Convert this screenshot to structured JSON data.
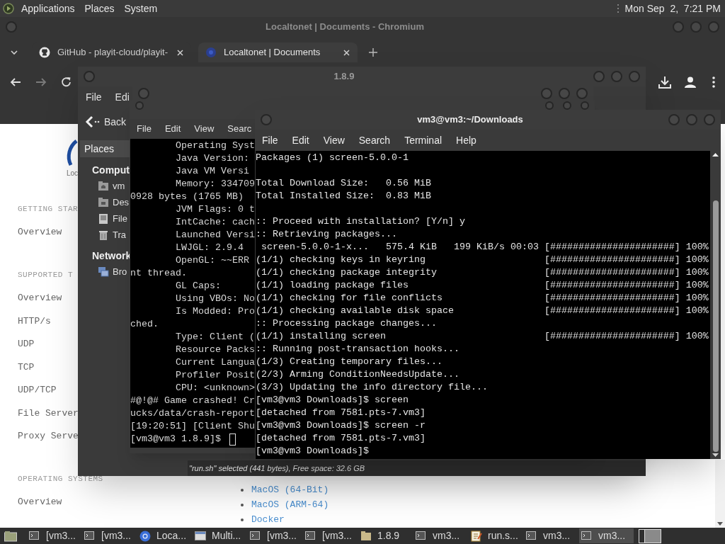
{
  "top_panel": {
    "menus": [
      "Applications",
      "Places",
      "System"
    ],
    "clock": "Mon Sep  2,  7:21 PM"
  },
  "browser": {
    "title": "Localtonet | Documents - Chromium",
    "tabs": [
      {
        "label": "GitHub - playit-cloud/playit-",
        "kind": "github",
        "selected": false
      },
      {
        "label": "Localtonet | Documents",
        "kind": "site",
        "selected": true
      }
    ],
    "forward_disabled": true,
    "page": {
      "logo_text": "Loc",
      "nav": [
        {
          "kind": "heading",
          "text": "GETTING STAR"
        },
        {
          "kind": "link",
          "text": "Overview"
        },
        {
          "kind": "heading",
          "text": "SUPPORTED T"
        },
        {
          "kind": "link",
          "text": "Overview"
        },
        {
          "kind": "link",
          "text": "HTTP/s"
        },
        {
          "kind": "link",
          "text": "UDP"
        },
        {
          "kind": "link",
          "text": "TCP"
        },
        {
          "kind": "link",
          "text": "UDP/TCP"
        },
        {
          "kind": "link",
          "text": "File Server"
        },
        {
          "kind": "link",
          "text": "Proxy Serve"
        },
        {
          "kind": "heading",
          "text": "OPERATING SYSTEMS"
        },
        {
          "kind": "link",
          "text": "Overview"
        }
      ],
      "list": [
        "MacOS (64-Bit)",
        "MacOS (ARM-64)",
        "Docker"
      ]
    }
  },
  "file_manager": {
    "title": "1.8.9",
    "menus": [
      "File",
      "Edi"
    ],
    "back": "Back",
    "places_header": "Places",
    "sidebar": [
      {
        "kind": "heading",
        "text": "Comput"
      },
      {
        "kind": "home",
        "text": "vm"
      },
      {
        "kind": "desktop",
        "text": "Des"
      },
      {
        "kind": "drive",
        "text": "File"
      },
      {
        "kind": "trash",
        "text": "Tra"
      },
      {
        "kind": "heading",
        "text": "Network"
      },
      {
        "kind": "network",
        "text": "Bro"
      }
    ],
    "status": "\"run.sh\" selected (441 bytes), Free space: 32.6 GB"
  },
  "terminal_back": {
    "menus": [
      "File",
      "Edit",
      "View",
      "Searc"
    ],
    "lines": [
      {
        "text": "Operating Syst",
        "indented": true
      },
      {
        "text": "Java Version:",
        "indented": true
      },
      {
        "text": "Java VM Versi",
        "indented": true
      },
      {
        "text": "Memory: 334709",
        "indented": true
      },
      {
        "text": "0928 bytes (1765 MB)",
        "indented": false
      },
      {
        "text": "JVM Flags: 0 t",
        "indented": true
      },
      {
        "text": "IntCache: cach",
        "indented": true
      },
      {
        "text": "Launched Versi",
        "indented": true
      },
      {
        "text": "LWJGL: 2.9.4",
        "indented": true
      },
      {
        "text": "OpenGL: ~~ERR",
        "indented": true
      },
      {
        "text": "nt thread.",
        "indented": false
      },
      {
        "text": "GL Caps:",
        "indented": true
      },
      {
        "text": "Using VBOs: No",
        "indented": true
      },
      {
        "text": "Is Modded: Pro",
        "indented": true
      },
      {
        "text": "ched.",
        "indented": false
      },
      {
        "text": "Type: Client (",
        "indented": true
      },
      {
        "text": "Resource Packs",
        "indented": true
      },
      {
        "text": "Current Langua",
        "indented": true
      },
      {
        "text": "Profiler Posit",
        "indented": true
      },
      {
        "text": "CPU: <unknown>",
        "indented": true
      },
      {
        "text": "#@!@# Game crashed! Cr",
        "indented": false
      },
      {
        "text": "ucks/data/crash-report",
        "indented": false
      },
      {
        "text": "[19:20:51] [Client Shu",
        "indented": false
      },
      {
        "text": "[vm3@vm3 1.8.9]$",
        "indented": false,
        "cursor": true
      }
    ]
  },
  "terminal_front": {
    "title": "vm3@vm3:~/Downloads",
    "menus": [
      "File",
      "Edit",
      "View",
      "Search",
      "Terminal",
      "Help"
    ],
    "paragraphs": [
      [
        "Packages (1) screen-5.0.0-1"
      ],
      [
        "Total Download Size:   0.56 MiB",
        "Total Installed Size:  0.83 MiB"
      ],
      [
        ":: Proceed with installation? [Y/n] y",
        ":: Retrieving packages...",
        " screen-5.0.0-1-x...   575.4 KiB   199 KiB/s 00:03 [######################] 100%",
        "(1/1) checking keys in keyring                     [######################] 100%",
        "(1/1) checking package integrity                   [######################] 100%",
        "(1/1) loading package files                        [######################] 100%",
        "(1/1) checking for file conflicts                  [######################] 100%",
        "(1/1) checking available disk space                [######################] 100%",
        ":: Processing package changes...",
        "(1/1) installing screen                            [######################] 100%",
        ":: Running post-transaction hooks...",
        "(1/3) Creating temporary files...",
        "(2/3) Arming ConditionNeedsUpdate...",
        "(3/3) Updating the info directory file...",
        "[vm3@vm3 Downloads]$ screen",
        "[detached from 7581.pts-7.vm3]",
        "[vm3@vm3 Downloads]$ screen -r",
        "[detached from 7581.pts-7.vm3]",
        "[vm3@vm3 Downloads]$"
      ]
    ]
  },
  "taskbar": {
    "items": [
      {
        "kind": "desktop"
      },
      {
        "kind": "terminal",
        "label": "[vm3...",
        "selected": false
      },
      {
        "kind": "terminal",
        "label": "[vm3...",
        "selected": false
      },
      {
        "kind": "browser",
        "label": "Loca...",
        "selected": false
      },
      {
        "kind": "window",
        "label": "Multi...",
        "selected": false
      },
      {
        "kind": "terminal",
        "label": "[vm3...",
        "selected": false
      },
      {
        "kind": "terminal",
        "label": "[vm3...",
        "selected": false
      },
      {
        "kind": "folder",
        "label": "1.8.9",
        "selected": false
      },
      {
        "kind": "terminal",
        "label": "vm3...",
        "selected": false
      },
      {
        "kind": "editor",
        "label": "run.s...",
        "selected": false
      },
      {
        "kind": "terminal",
        "label": "vm3...",
        "selected": false
      },
      {
        "kind": "terminal",
        "label": "vm3...",
        "selected": true
      },
      {
        "kind": "workspaces"
      }
    ]
  }
}
